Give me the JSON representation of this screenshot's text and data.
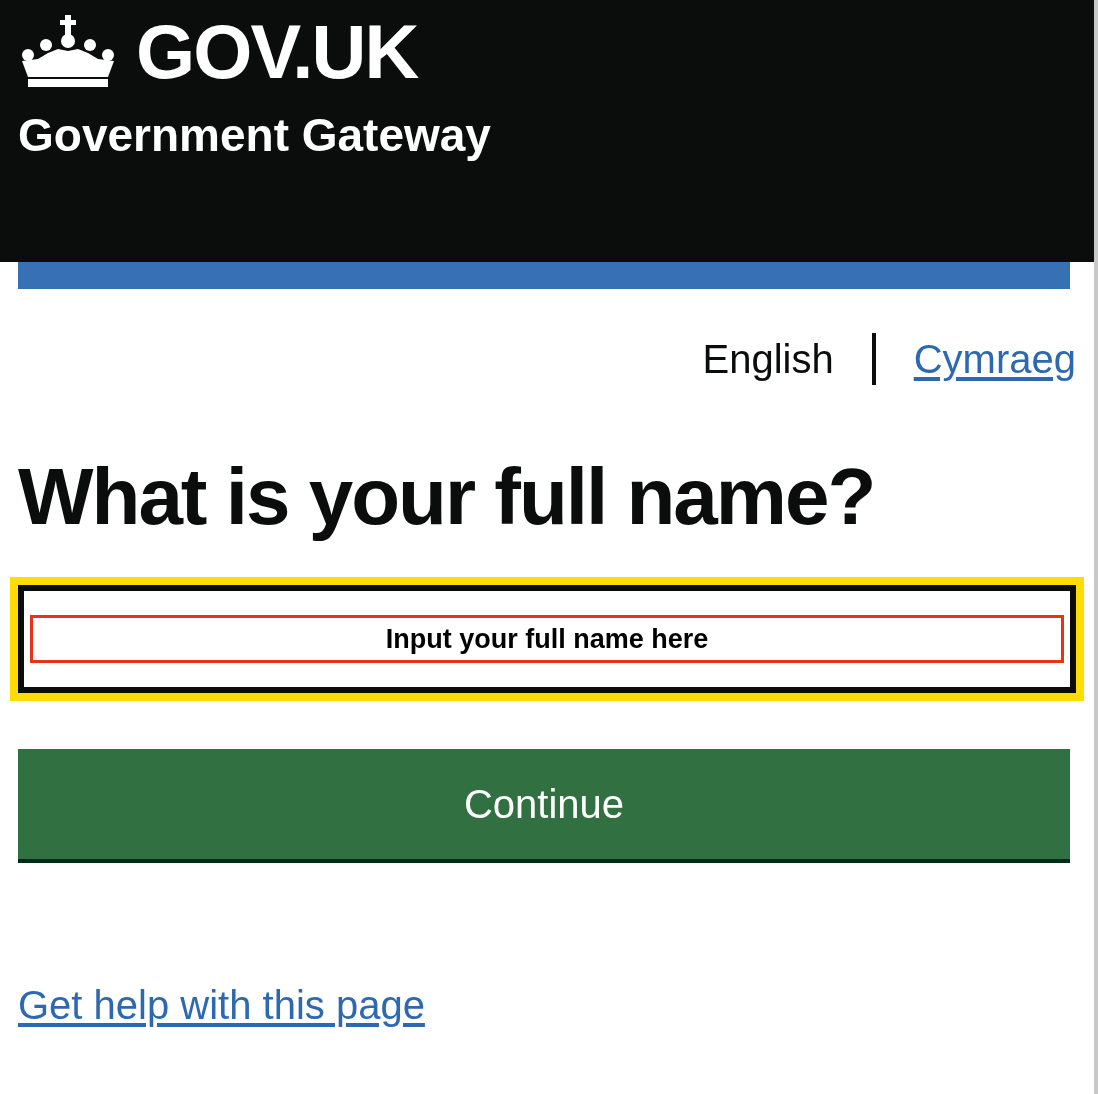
{
  "header": {
    "logo_text": "GOV.UK",
    "service_name": "Government Gateway"
  },
  "language": [
    {
      "label": "English",
      "selected": true
    },
    {
      "label": "Cymraeg",
      "selected": false
    }
  ],
  "heading": "What is your full name?",
  "name_field": {
    "focused": true,
    "annotation": "Input your full name here"
  },
  "button": "Continue",
  "help_link": "Get help with this page"
}
